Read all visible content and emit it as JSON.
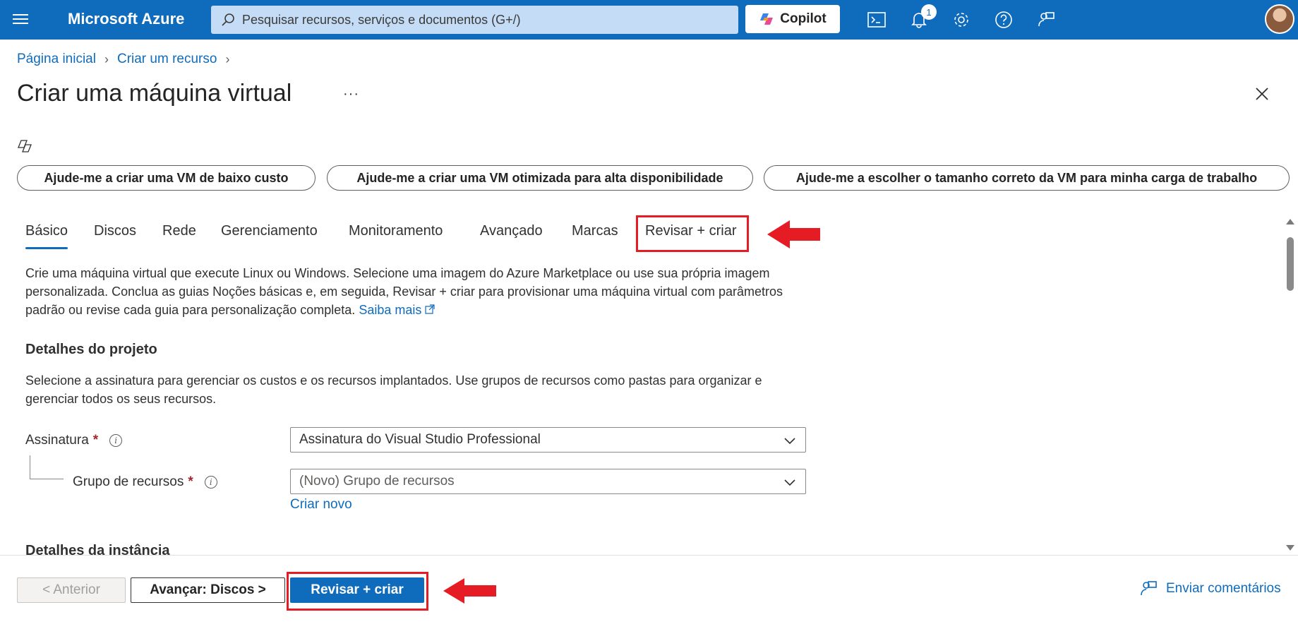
{
  "header": {
    "brand": "Microsoft Azure",
    "search_placeholder": "Pesquisar recursos, serviços e documentos (G+/)",
    "copilot_label": "Copilot",
    "notification_count": "1"
  },
  "breadcrumb": [
    "Página inicial",
    "Criar um recurso"
  ],
  "page": {
    "title": "Criar uma máquina virtual",
    "more": "···"
  },
  "prompts": [
    "Ajude-me a criar uma VM de baixo custo",
    "Ajude-me a criar uma VM otimizada para alta disponibilidade",
    "Ajude-me a escolher o tamanho correto da VM para minha carga de trabalho"
  ],
  "tabs": [
    "Básico",
    "Discos",
    "Rede",
    "Gerenciamento",
    "Monitoramento",
    "Avançado",
    "Marcas",
    "Revisar + criar"
  ],
  "intro": {
    "text": "Crie uma máquina virtual que execute Linux ou Windows. Selecione uma imagem do Azure Marketplace ou use sua própria imagem personalizada. Conclua as guias Noções básicas e, em seguida, Revisar + criar para provisionar uma máquina virtual com parâmetros padrão ou revise cada guia para personalização completa.",
    "link": "Saiba mais"
  },
  "project": {
    "title": "Detalhes do projeto",
    "description": "Selecione a assinatura para gerenciar os custos e os recursos implantados. Use grupos de recursos como pastas para organizar e gerenciar todos os seus recursos.",
    "subscription_label": "Assinatura",
    "subscription_value": "Assinatura do Visual Studio Professional",
    "resource_group_label": "Grupo de recursos",
    "resource_group_value": "(Novo) Grupo de recursos",
    "create_new": "Criar novo",
    "required_mark": "*"
  },
  "instance": {
    "title": "Detalhes da instância"
  },
  "footer": {
    "prev": "< Anterior",
    "next": "Avançar: Discos >",
    "review": "Revisar + criar",
    "feedback": "Enviar comentários"
  },
  "colors": {
    "brand_blue": "#0f6cbd",
    "highlight_red": "#e51c23"
  }
}
